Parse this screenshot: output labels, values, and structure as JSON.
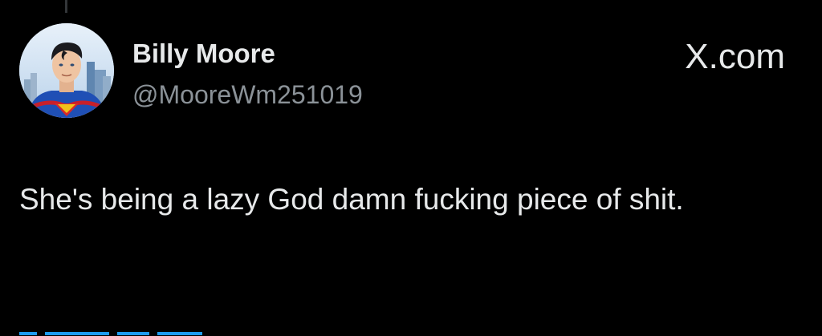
{
  "tweet": {
    "author": {
      "display_name": "Billy Moore",
      "handle": "@MooreWm251019",
      "avatar_icon": "profile-photo-superman"
    },
    "brand_label": "X.com",
    "text": "She's being a lazy God damn fucking piece of shit."
  },
  "colors": {
    "background": "#000000",
    "primary_text": "#e7e9ea",
    "secondary_text": "#8b9298",
    "link": "#1d9bf0"
  }
}
